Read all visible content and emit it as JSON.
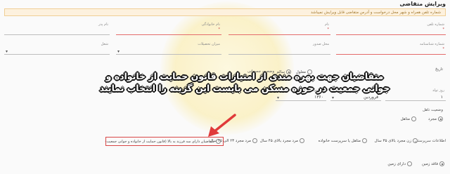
{
  "header": {
    "title": "ویرایش متقاضی"
  },
  "notice": {
    "text": "شماره تلفن همراه و شهر محل درخواست و آدرس متقاضی قابل ویرایش نمیباشد"
  },
  "row1": [
    {
      "label": "شماره تلفن",
      "required": true
    },
    {
      "label": "نام",
      "required": true
    },
    {
      "label": "نام خانوادگی",
      "required": true
    },
    {
      "label": "نام پدر",
      "required": false
    }
  ],
  "row2": [
    {
      "label": "شماره شناسنامه",
      "required": true
    },
    {
      "label": "محل صدور",
      "required": false
    },
    {
      "label": "میزان تحصیلات",
      "required": false
    },
    {
      "label": "شغل",
      "required": false
    }
  ],
  "gender": {
    "label": "جنسیت",
    "options": [
      {
        "label": "مرد",
        "selected": true
      },
      {
        "label": "زن",
        "selected": false
      }
    ]
  },
  "marital": {
    "label": "وضعیت جسمانی",
    "options": [
      {
        "label": "سالم",
        "selected": true
      },
      {
        "label": "معلول",
        "selected": false
      }
    ]
  },
  "birth": {
    "label": "تاریخ",
    "day_label": "روز تولد",
    "month_label": "ماه تولد",
    "year_label": "سال تولد",
    "day": "۱",
    "month": "فروردین",
    "year": "۱۳۶۰"
  },
  "overlay": {
    "line1": "متقاضیان جهت بهره مندی از امتیازات قانون حمایت از خانواده و",
    "line2": "جوانی جمعیت در حوزه مسکن می بایست این گزینه را انتخاب نمایند"
  },
  "marriage": {
    "label": "وضعیت تاهل",
    "options": [
      {
        "label": "متاهل",
        "selected": false
      },
      {
        "label": "مجرد",
        "selected": true
      }
    ]
  },
  "category": {
    "label": "اطلاعات سرپرستی",
    "options": [
      {
        "label": "زن مجرد بالای ۳۵ سال",
        "selected": false
      },
      {
        "label": "متاهل یا سرپرست خانواده",
        "selected": false
      },
      {
        "label": "مرد مجرد بالای ۴۵ سال",
        "selected": false
      },
      {
        "label": "مرد مجرد ۲۳ الی ۴۵ سال",
        "selected": false
      },
      {
        "label": "متقاضیان دارای سه فرزند به بالا (قانون حمایت از خانواده و جوانی جمعیت)",
        "selected": false
      }
    ]
  },
  "land": {
    "label": "",
    "options": [
      {
        "label": "فاقد زمین",
        "selected": true
      },
      {
        "label": "دارای زمین",
        "selected": false
      }
    ]
  }
}
